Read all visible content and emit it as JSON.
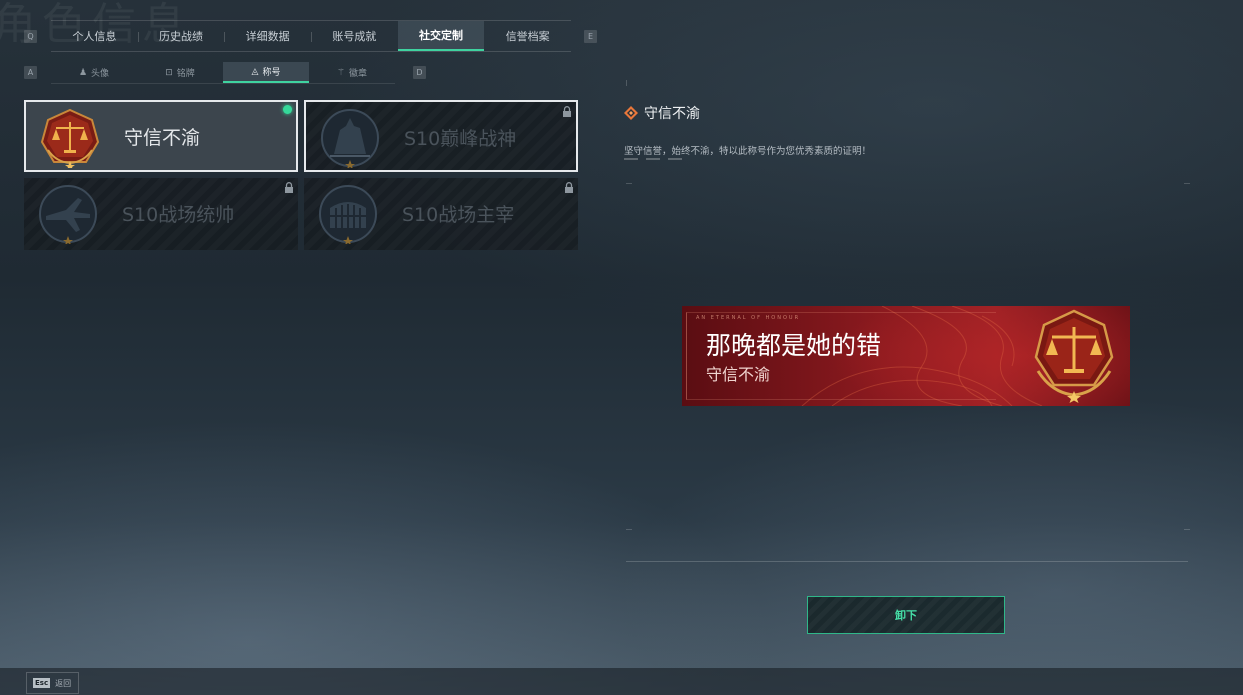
{
  "page": {
    "watermark": "角色信息"
  },
  "keys": {
    "prev_tab": "Q",
    "next_tab": "E",
    "prev_sub": "A",
    "next_sub": "D"
  },
  "main_tabs": [
    {
      "label": "个人信息",
      "active": false
    },
    {
      "label": "历史战绩",
      "active": false
    },
    {
      "label": "详细数据",
      "active": false
    },
    {
      "label": "账号成就",
      "active": false
    },
    {
      "label": "社交定制",
      "active": true
    },
    {
      "label": "信誉档案",
      "active": false
    }
  ],
  "sub_tabs": [
    {
      "label": "头像",
      "icon": "person-icon",
      "glyph": "♟",
      "active": false
    },
    {
      "label": "铭牌",
      "icon": "nameplate-icon",
      "glyph": "⊡",
      "active": false
    },
    {
      "label": "称号",
      "icon": "title-icon",
      "glyph": "◬",
      "active": true
    },
    {
      "label": "徽章",
      "icon": "badge-icon",
      "glyph": "⚚",
      "active": false
    }
  ],
  "titles": [
    {
      "label": "守信不渝",
      "emblem": "scales-emblem",
      "state": "equipped"
    },
    {
      "label": "S10巅峰战神",
      "emblem": "colossus-emblem",
      "state": "locked"
    },
    {
      "label": "S10战场统帅",
      "emblem": "aircraft-emblem",
      "state": "locked"
    },
    {
      "label": "S10战场主宰",
      "emblem": "colosseum-emblem",
      "state": "locked"
    }
  ],
  "detail": {
    "icon": "diamond-compass-icon",
    "title": "守信不渝",
    "description": "坚守信誉，始终不渝，特以此称号作为您优秀素质的证明！"
  },
  "banner": {
    "tiny_text": "AN ETERNAL  OF HONOUR",
    "player_name": "那晚都是她的错",
    "title": "守信不渝",
    "color": "#9e2125"
  },
  "actions": {
    "unequip_label": "卸下"
  },
  "footer": {
    "esc_key": "Esc",
    "back_label": "返回"
  },
  "colors": {
    "accent": "#3fd3a0",
    "equipped": "#35d99a",
    "banner_red": "#8c1a1f",
    "gold": "#d9a24a"
  }
}
